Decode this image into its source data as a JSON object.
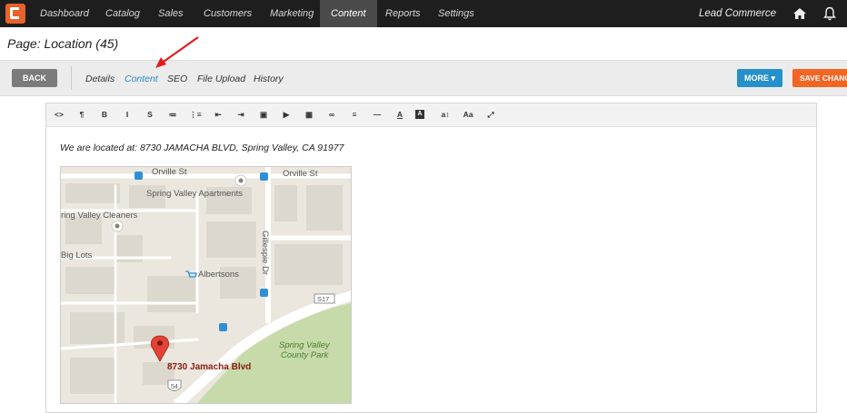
{
  "topnav": {
    "items": [
      {
        "label": "Dashboard",
        "active": false
      },
      {
        "label": "Catalog",
        "active": false
      },
      {
        "label": "Sales",
        "active": false
      },
      {
        "label": "Customers",
        "active": false
      },
      {
        "label": "Marketing",
        "active": false
      },
      {
        "label": "Content",
        "active": true
      },
      {
        "label": "Reports",
        "active": false
      },
      {
        "label": "Settings",
        "active": false
      }
    ],
    "brand": "Lead Commerce",
    "icons": [
      "logo-icon",
      "home-icon",
      "bell-icon"
    ]
  },
  "page": {
    "title": "Page: Location (45)"
  },
  "toolbar": {
    "back_label": "BACK",
    "tabs": [
      {
        "label": "Details",
        "active": false
      },
      {
        "label": "Content",
        "active": true
      },
      {
        "label": "SEO",
        "active": false
      },
      {
        "label": "File Upload",
        "active": false
      },
      {
        "label": "History",
        "active": false
      }
    ],
    "more_label": "MORE",
    "save_label": "SAVE CHANGES"
  },
  "editor": {
    "toolbar_buttons": [
      {
        "name": "code-view",
        "glyph": "<>"
      },
      {
        "name": "paragraph",
        "glyph": "¶"
      },
      {
        "name": "bold",
        "glyph": "B"
      },
      {
        "name": "italic",
        "glyph": "I"
      },
      {
        "name": "strikethrough",
        "glyph": "S"
      },
      {
        "name": "unordered-list",
        "glyph": "≔"
      },
      {
        "name": "ordered-list",
        "glyph": "⋮≡"
      },
      {
        "name": "outdent",
        "glyph": "⇤"
      },
      {
        "name": "indent",
        "glyph": "⇥"
      },
      {
        "name": "image",
        "glyph": "▣"
      },
      {
        "name": "video",
        "glyph": "▶"
      },
      {
        "name": "table",
        "glyph": "▦"
      },
      {
        "name": "link",
        "glyph": "∞"
      },
      {
        "name": "align",
        "glyph": "≡"
      },
      {
        "name": "horizontal-rule",
        "glyph": "—"
      },
      {
        "name": "font-color",
        "glyph": "A"
      },
      {
        "name": "background-color",
        "glyph": "A"
      },
      {
        "name": "font-size",
        "glyph": "a↕"
      },
      {
        "name": "font-family",
        "glyph": "Aa"
      },
      {
        "name": "fullscreen",
        "glyph": "⤢"
      }
    ],
    "content_text": "We are located at: 8730 JAMACHA BLVD, Spring Valley, CA 91977"
  },
  "map": {
    "labels": {
      "street1": "Orville St",
      "street2": "Orville St",
      "apartments": "Spring Valley Apartments",
      "cleaners": "ring Valley Cleaners",
      "biglots": "Big Lots",
      "albertsons": "Albertsons",
      "gillespie": "Gillespie Dr",
      "route_s17": "S17",
      "park": "Spring Valley County Park",
      "address": "8730 Jamacha Blvd",
      "route_54": "54"
    }
  }
}
